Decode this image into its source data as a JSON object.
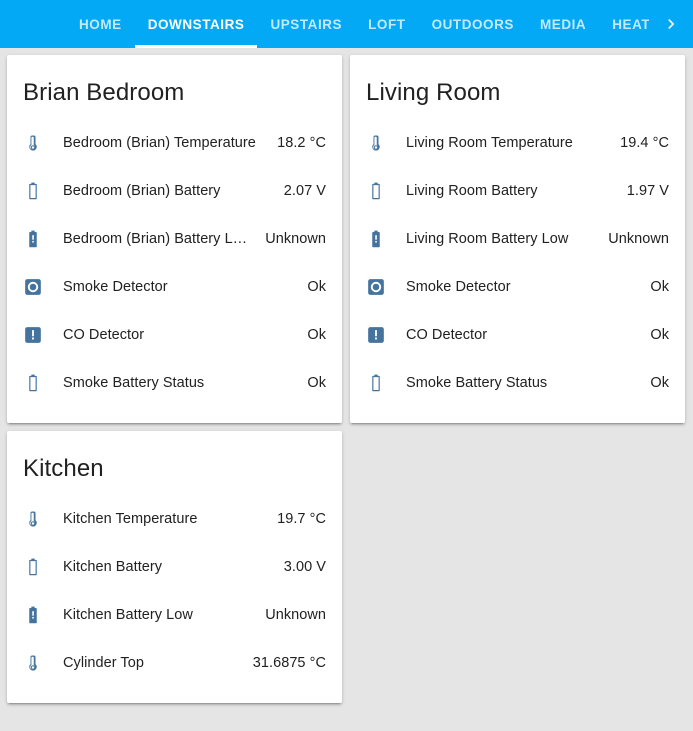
{
  "theme": {
    "header_bg": "#03a9f4",
    "page_bg": "#e5e5e5",
    "card_bg": "#ffffff",
    "icon_color": "#44739e",
    "text_color": "#212121",
    "active_tab_color": "#ffffff"
  },
  "header": {
    "tabs": [
      {
        "label": "HOME",
        "active": false
      },
      {
        "label": "DOWNSTAIRS",
        "active": true
      },
      {
        "label": "UPSTAIRS",
        "active": false
      },
      {
        "label": "LOFT",
        "active": false
      },
      {
        "label": "OUTDOORS",
        "active": false
      },
      {
        "label": "MEDIA",
        "active": false
      },
      {
        "label": "HEATING &",
        "active": false
      }
    ],
    "overflow_arrow": "chevron-right-icon"
  },
  "columns": [
    {
      "cards": [
        {
          "title": "Brian Bedroom",
          "rows": [
            {
              "icon": "thermometer",
              "name": "Bedroom (Brian) Temperature",
              "value": "18.2 °C"
            },
            {
              "icon": "battery",
              "name": "Bedroom (Brian) Battery",
              "value": "2.07 V"
            },
            {
              "icon": "battery-alert",
              "name": "Bedroom (Brian) Battery L…",
              "value": "Unknown"
            },
            {
              "icon": "smoke-detector",
              "name": "Smoke Detector",
              "value": "Ok"
            },
            {
              "icon": "alert-box",
              "name": "CO Detector",
              "value": "Ok"
            },
            {
              "icon": "battery",
              "name": "Smoke Battery Status",
              "value": "Ok"
            }
          ]
        },
        {
          "title": "Kitchen",
          "rows": [
            {
              "icon": "thermometer",
              "name": "Kitchen Temperature",
              "value": "19.7 °C"
            },
            {
              "icon": "battery",
              "name": "Kitchen Battery",
              "value": "3.00 V"
            },
            {
              "icon": "battery-alert",
              "name": "Kitchen Battery Low",
              "value": "Unknown"
            },
            {
              "icon": "thermometer",
              "name": "Cylinder Top",
              "value": "31.6875 °C"
            }
          ]
        }
      ]
    },
    {
      "cards": [
        {
          "title": "Living Room",
          "rows": [
            {
              "icon": "thermometer",
              "name": "Living Room Temperature",
              "value": "19.4 °C"
            },
            {
              "icon": "battery",
              "name": "Living Room Battery",
              "value": "1.97 V"
            },
            {
              "icon": "battery-alert",
              "name": "Living Room Battery Low",
              "value": "Unknown"
            },
            {
              "icon": "smoke-detector",
              "name": "Smoke Detector",
              "value": "Ok"
            },
            {
              "icon": "alert-box",
              "name": "CO Detector",
              "value": "Ok"
            },
            {
              "icon": "battery",
              "name": "Smoke Battery Status",
              "value": "Ok"
            }
          ]
        }
      ]
    }
  ]
}
